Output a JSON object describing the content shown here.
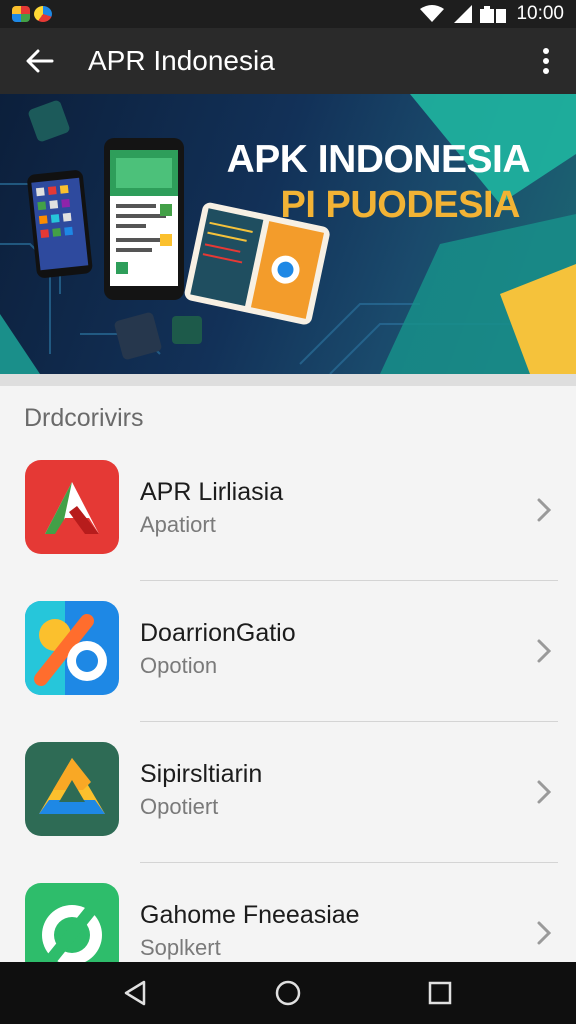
{
  "status_bar": {
    "time": "10:00",
    "icons": [
      "notification-icon",
      "wifi-icon",
      "signal-icon",
      "battery-icon"
    ]
  },
  "app_bar": {
    "title": "APR Indonesia",
    "back_icon": "arrow-back-icon",
    "menu_icon": "more-vert-icon"
  },
  "banner": {
    "title": "APK INDONESIA",
    "subtitle": "PI PUODESIA"
  },
  "section": {
    "header": "Drdcorivirs"
  },
  "items": [
    {
      "title": "APR Lirliasia",
      "subtitle": "Apatiort",
      "icon": "red-arrow-app-icon"
    },
    {
      "title": "DoarrionGatio",
      "subtitle": "Opotion",
      "icon": "blue-link-app-icon"
    },
    {
      "title": "Sipirsltiarin",
      "subtitle": "Opotiert",
      "icon": "green-triangle-app-icon"
    },
    {
      "title": "Gahome Fneeasiae",
      "subtitle": "Soplkert",
      "icon": "green-leaf-app-icon"
    }
  ],
  "nav": {
    "back": "nav-back-icon",
    "home": "nav-home-icon",
    "recents": "nav-recents-icon"
  },
  "colors": {
    "app_bar": "#2a2a2a",
    "status_bar": "#1e1e1e",
    "banner_accent": "#f2b335",
    "teal": "#1fb5a0"
  }
}
